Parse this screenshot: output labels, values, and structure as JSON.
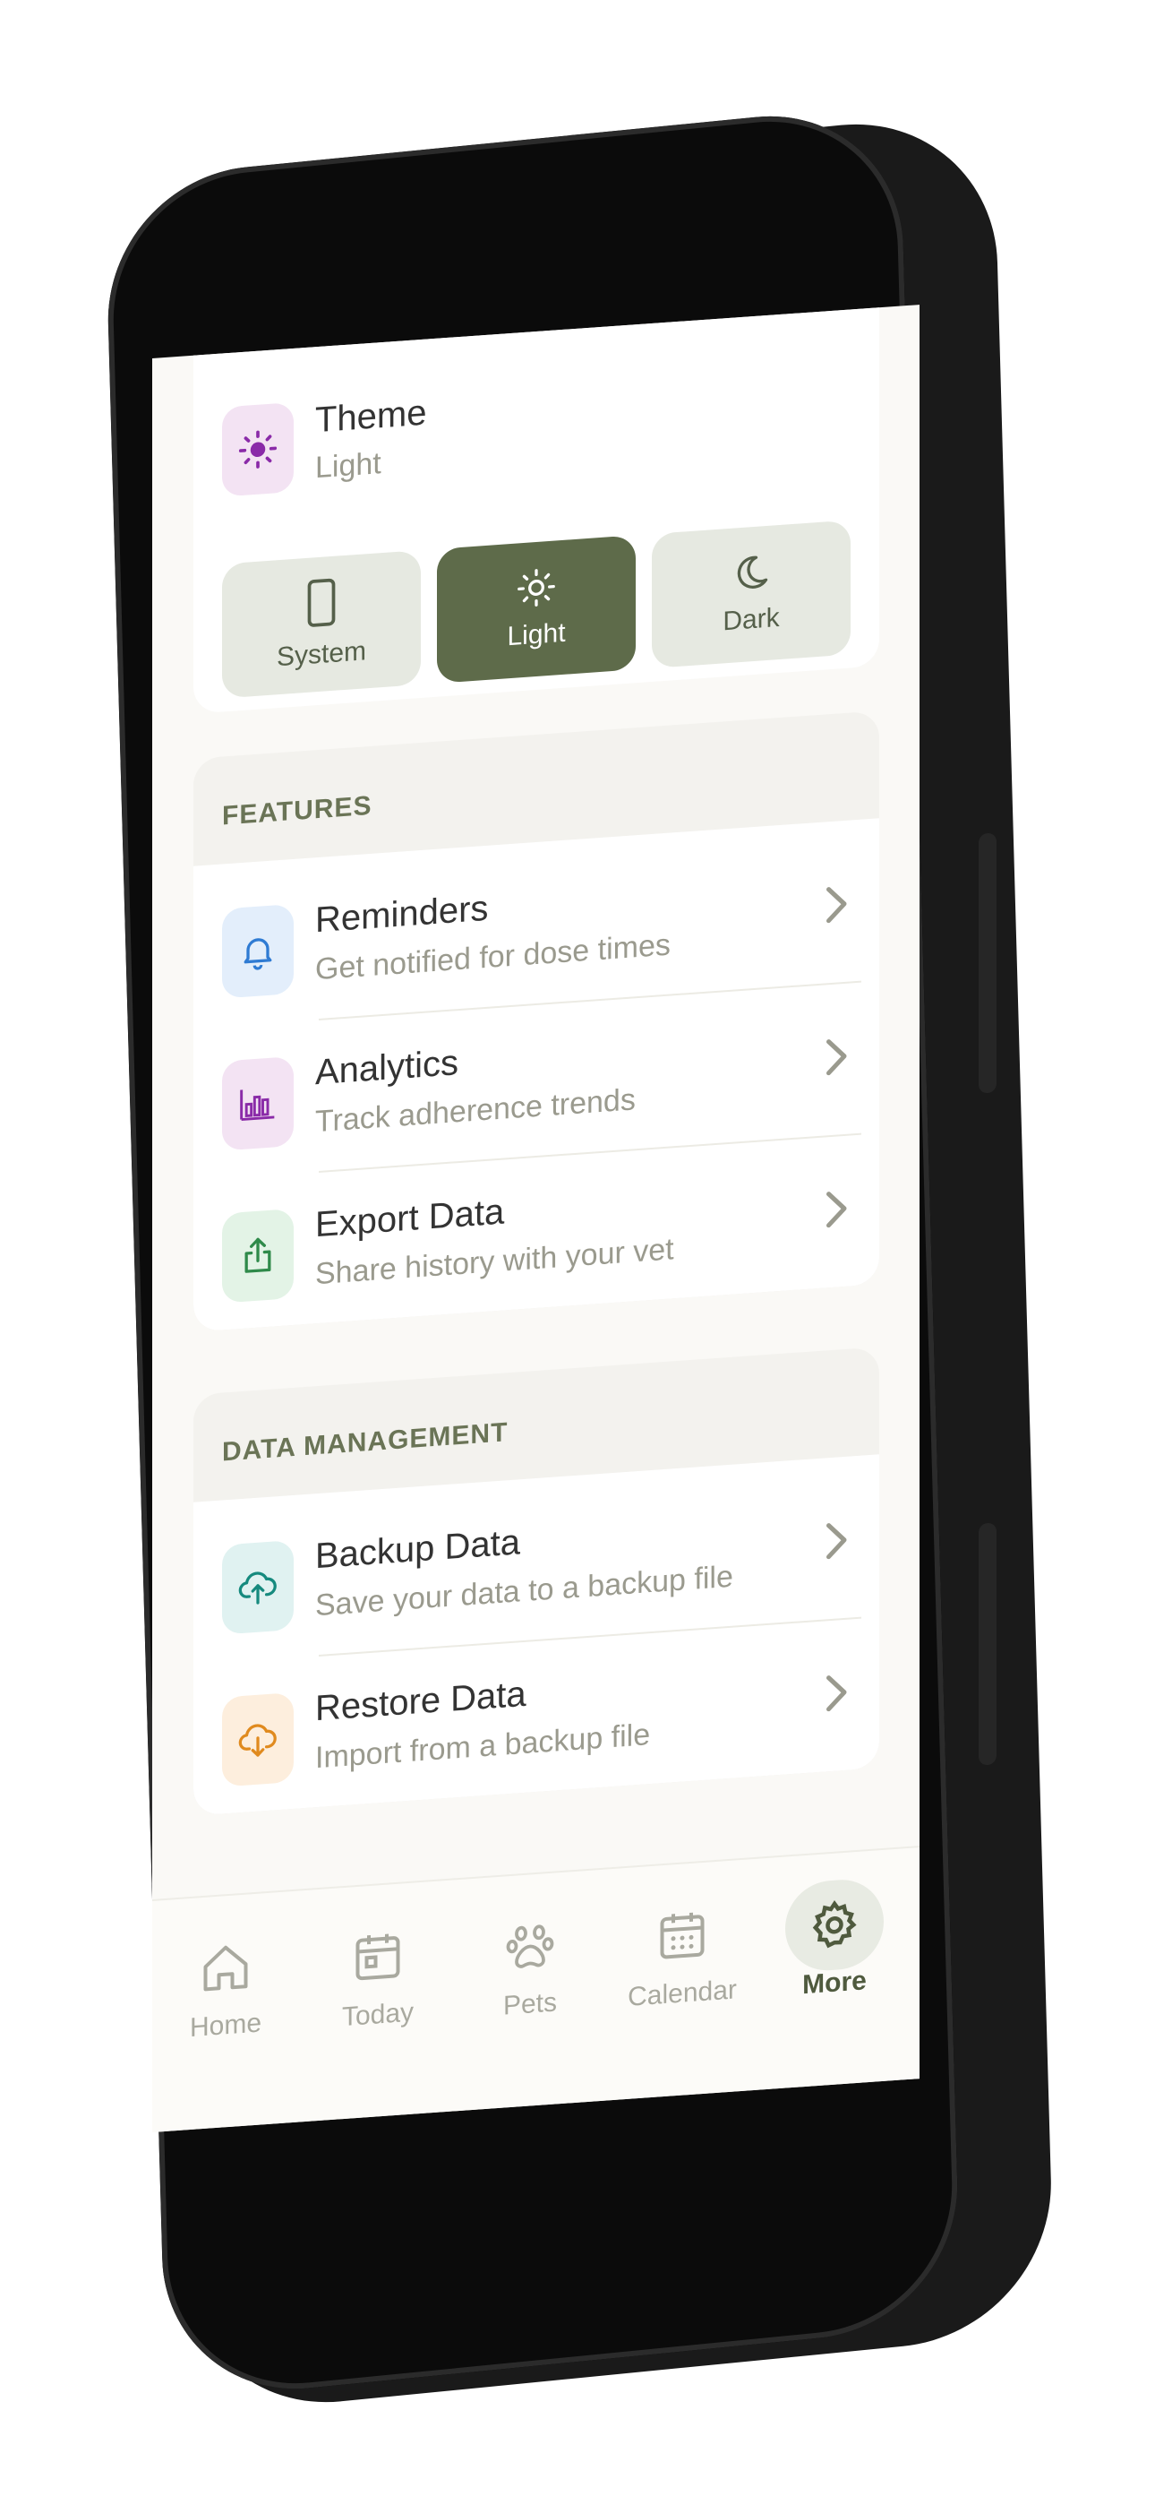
{
  "theme": {
    "title": "Theme",
    "value": "Light",
    "options": [
      {
        "label": "System",
        "icon": "phone-icon",
        "active": false
      },
      {
        "label": "Light",
        "icon": "sun-icon",
        "active": true
      },
      {
        "label": "Dark",
        "icon": "moon-icon",
        "active": false
      }
    ]
  },
  "features": {
    "label": "FEATURES",
    "items": [
      {
        "title": "Reminders",
        "subtitle": "Get notified for dose times",
        "icon": "bell-icon"
      },
      {
        "title": "Analytics",
        "subtitle": "Track adherence trends",
        "icon": "bar-chart-icon"
      },
      {
        "title": "Export Data",
        "subtitle": "Share history with your vet",
        "icon": "share-icon"
      }
    ]
  },
  "data_management": {
    "label": "DATA MANAGEMENT",
    "items": [
      {
        "title": "Backup Data",
        "subtitle": "Save your data to a backup file",
        "icon": "cloud-upload-icon"
      },
      {
        "title": "Restore Data",
        "subtitle": "Import from a backup file",
        "icon": "cloud-download-icon"
      }
    ]
  },
  "tabbar": {
    "items": [
      {
        "label": "Home",
        "icon": "home-icon",
        "active": false
      },
      {
        "label": "Today",
        "icon": "today-icon",
        "active": false
      },
      {
        "label": "Pets",
        "icon": "paw-icon",
        "active": false
      },
      {
        "label": "Calendar",
        "icon": "calendar-icon",
        "active": false
      },
      {
        "label": "More",
        "icon": "gear-icon",
        "active": true
      }
    ]
  },
  "colors": {
    "accent": "#5e6b4a",
    "background": "#faf9f6",
    "card": "#ffffff",
    "theme_icon_bg": "#f3e3f3",
    "reminders_icon_bg": "#e3eefb",
    "analytics_icon_bg": "#f3e3f3",
    "export_icon_bg": "#e3f3e6",
    "backup_icon_bg": "#e0f2f1",
    "restore_icon_bg": "#fdeedd"
  }
}
